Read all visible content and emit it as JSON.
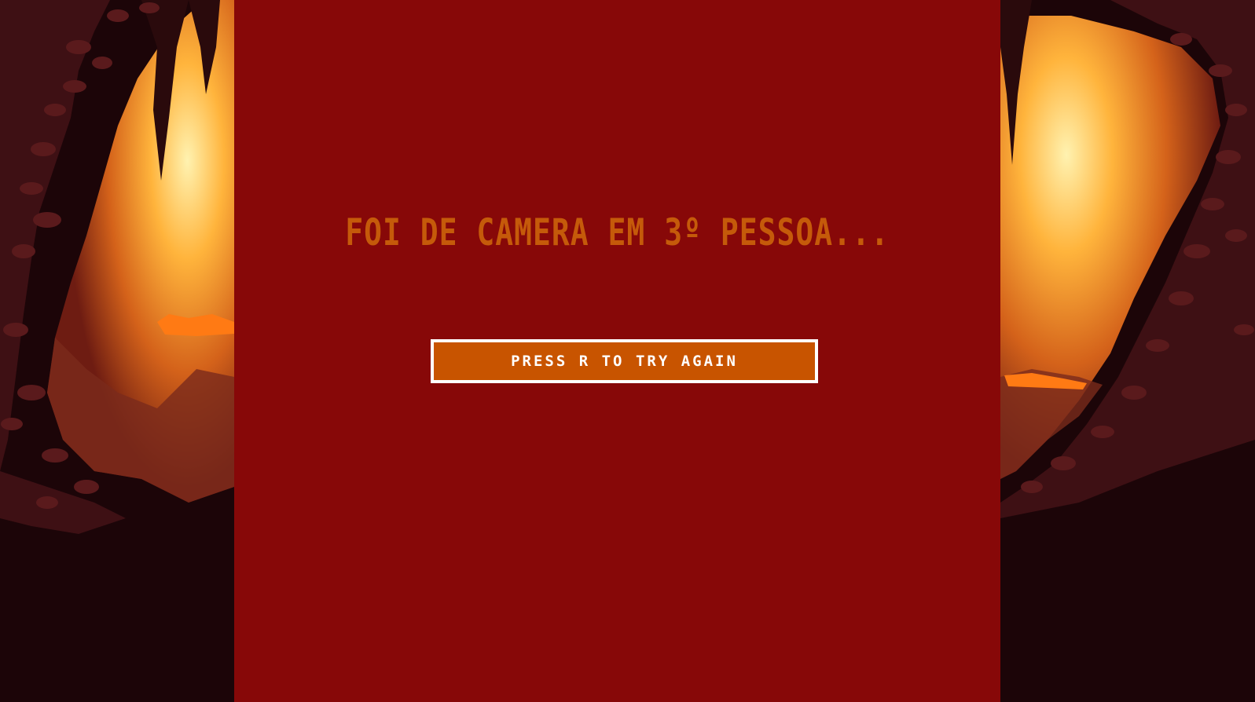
{
  "game_over": {
    "message": "FOI DE CAMERA EM 3º PESSOA...",
    "retry_label": "PRESS R TO TRY AGAIN"
  },
  "colors": {
    "panel_background": "#870808",
    "title_text": "#c55a0a",
    "button_fill": "#c85400",
    "button_border": "#ffffff",
    "button_text": "#ffffff",
    "cave_dark": "#1c0508",
    "cave_rock": "#3e1014",
    "cave_glow": "#ffb43c",
    "cave_lava": "#ff7a14"
  },
  "scene": {
    "left_art": "cave-wall-art",
    "right_art": "cave-wall-art"
  }
}
